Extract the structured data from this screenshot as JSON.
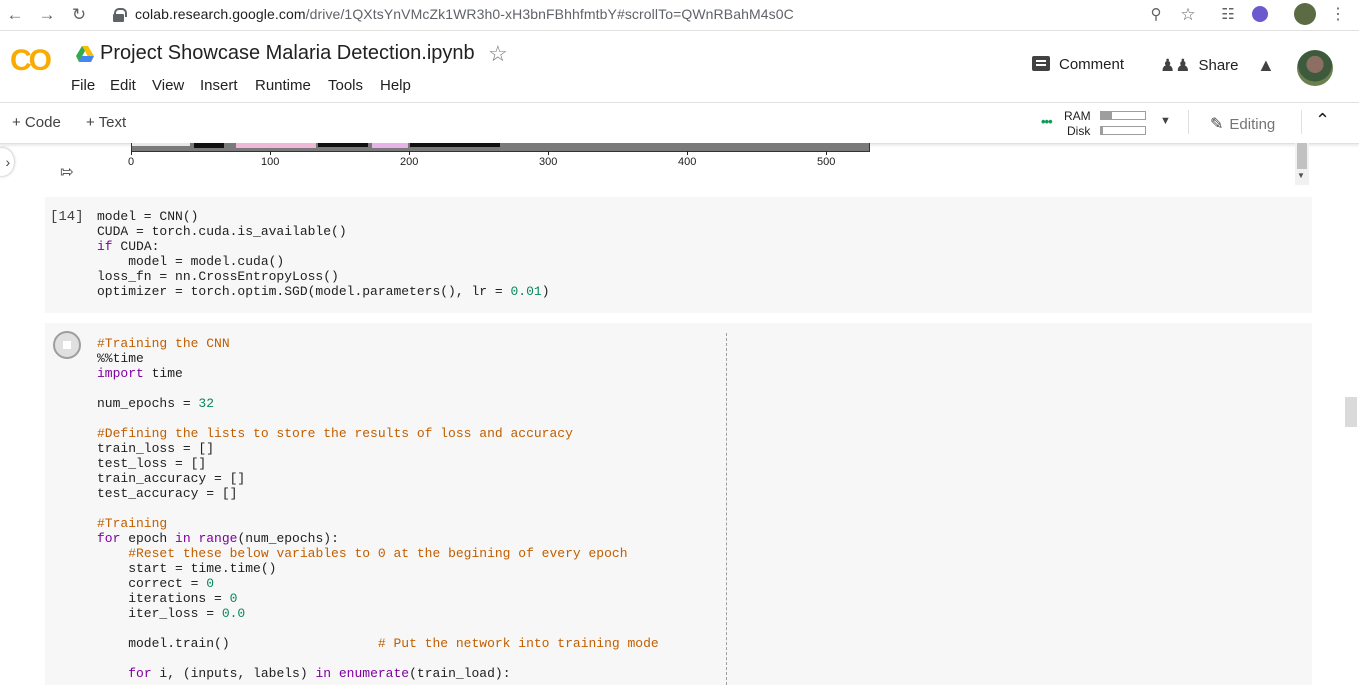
{
  "browser": {
    "url_host": "colab.research.google.com",
    "url_path": "/drive/1QXtsYnVMcZk1WR3h0-xH3bnFBhhfmtbY#scrollTo=QWnRBahM4s0C",
    "icons": [
      "back-icon",
      "forward-icon",
      "reload-icon",
      "lock-icon",
      "zoom-icon",
      "bookmark-star-icon",
      "globe-extension-icon",
      "ws-extension-icon",
      "profile-avatar-icon",
      "kebab-menu-icon"
    ]
  },
  "colab": {
    "logo": "CO",
    "title": "Project Showcase Malaria Detection.ipynb",
    "menu": [
      "File",
      "Edit",
      "View",
      "Insert",
      "Runtime",
      "Tools",
      "Help"
    ],
    "comment_label": "Comment",
    "share_label": "Share"
  },
  "toolbar": {
    "add_code": "+ Code",
    "add_text": "+ Text",
    "ram_label": "RAM",
    "disk_label": "Disk",
    "ram_fraction": 0.25,
    "disk_fraction": 0.05,
    "editing_label": "Editing"
  },
  "output": {
    "x_ticks": [
      "0",
      "100",
      "200",
      "300",
      "400",
      "500"
    ]
  },
  "cells": [
    {
      "execution_count": "[14]",
      "code": "model = CNN()\nCUDA = torch.cuda.is_available()\nif CUDA:\n    model = model.cuda()\nloss_fn = nn.CrossEntropyLoss()\noptimizer = torch.optim.SGD(model.parameters(), lr = 0.01)"
    },
    {
      "execution_count": "",
      "status": "running",
      "code": "#Training the CNN\n%%time\nimport time\n\nnum_epochs = 32\n\n#Defining the lists to store the results of loss and accuracy\ntrain_loss = []\ntest_loss = []\ntrain_accuracy = []\ntest_accuracy = []\n\n#Training\nfor epoch in range(num_epochs):\n    #Reset these below variables to 0 at the begining of every epoch\n    start = time.time()\n    correct = 0\n    iterations = 0\n    iter_loss = 0.0\n\n    model.train()                   # Put the network into training mode\n\n    for i, (inputs, labels) in enumerate(train_load):"
    }
  ],
  "colors": {
    "logo": "#f9ab00",
    "keyword": "#8000a0",
    "comment": "#c25e00",
    "number": "#09885a",
    "cell_bg": "#f7f7f7",
    "resource_ok": "#0f9d58"
  }
}
